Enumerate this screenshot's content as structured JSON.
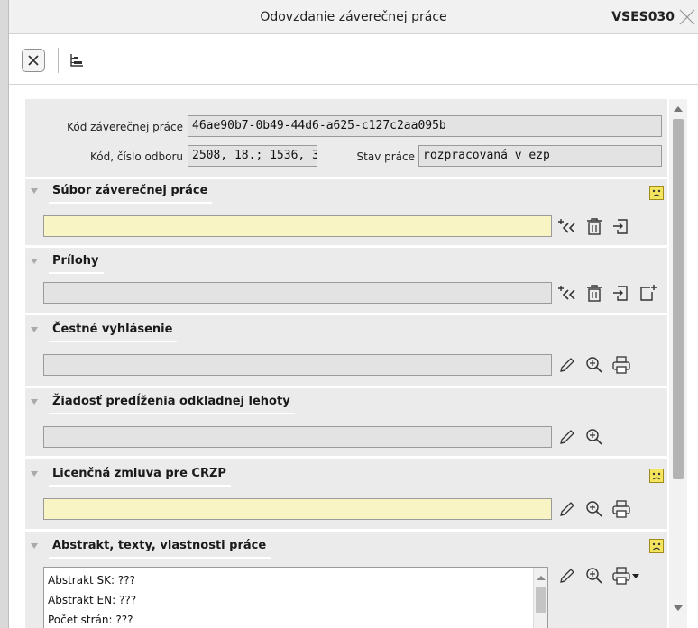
{
  "window": {
    "title": "Odovzdanie záverečnej práce",
    "code": "VSES030",
    "close_icon": "close-x-icon"
  },
  "toolbar": {
    "close_icon": "close-box-icon",
    "tree_icon": "tree-hierarchy-icon"
  },
  "form": {
    "thesis_code_label": "Kód záverečnej práce",
    "thesis_code_value": "46ae90b7-0b49-44d6-a625-c127c2aa095b",
    "field_code_label": "Kód, číslo odboru",
    "field_code_value": "2508, 18.; 1536, 3",
    "state_label": "Stav práce",
    "state_value": "rozpracovaná v ezp"
  },
  "sections": {
    "file": {
      "title": "Súbor záverečnej práce"
    },
    "attachments": {
      "title": "Prílohy"
    },
    "declaration": {
      "title": "Čestné vyhlásenie"
    },
    "extension": {
      "title": "Žiadosť predĺženia odkladnej lehoty"
    },
    "license": {
      "title": "Licenčná zmluva pre CRZP"
    },
    "abstract": {
      "title": "Abstrakt, texty, vlastnosti práce",
      "lines": [
        "Abstrakt SK: ???",
        "Abstrakt EN: ???",
        "Počet strán: ???"
      ]
    }
  },
  "icons": [
    "sad-face-icon",
    "insert-arrows-icon",
    "trash-icon",
    "import-icon",
    "new-document-icon",
    "edit-pencil-icon",
    "zoom-icon",
    "print-icon",
    "dropdown-arrow-icon"
  ],
  "colors": {
    "required_field": "#f8f4c4",
    "readonly_field": "#e3e3e3",
    "panel_bg": "#ebebeb",
    "warning_face": "#f5e45e"
  }
}
